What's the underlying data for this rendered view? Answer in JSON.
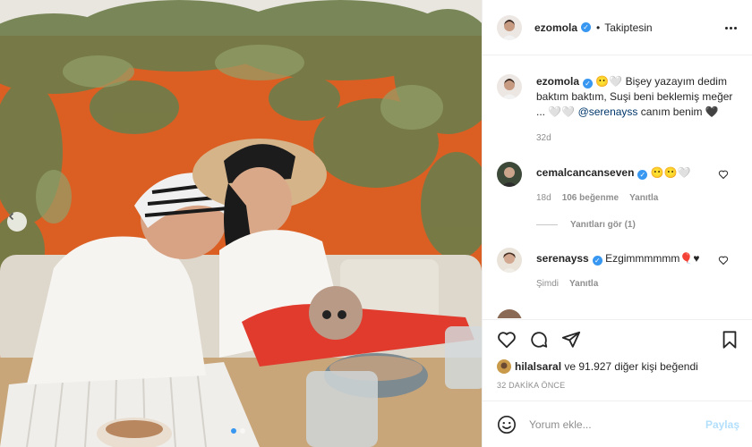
{
  "post": {
    "author": "ezomola",
    "follow_status": "Takiptesin",
    "caption_text": "😶🤍 Bişey yazayım dedim baktım baktım, Suşi beni beklemiş meğer ... 🤍🤍",
    "caption_mention": "@serenayss",
    "caption_tail": "canım benim 🖤",
    "caption_time": "32d"
  },
  "comments": [
    {
      "user": "cemalcancanseven",
      "text": "😶😶🤍",
      "time": "18d",
      "likes": "106 beğenme",
      "reply": "Yanıtla",
      "view_replies": "Yanıtları gör (1)"
    },
    {
      "user": "serenayss",
      "text": "Ezgimmmmmm🎈♥",
      "time": "Şimdi",
      "reply": "Yanıtla"
    }
  ],
  "likes": {
    "user": "hilalsaral",
    "rest": "ve 91.927 diğer kişi beğendi"
  },
  "posted_ago": "32 DAKİKA ÖNCE",
  "comment_box": {
    "placeholder": "Yorum ekle...",
    "post_label": "Paylaş"
  },
  "icons": {
    "like": "heart-icon",
    "comment": "comment-icon",
    "share": "paper-plane-icon",
    "save": "bookmark-icon",
    "emoji": "smiley-icon",
    "prev": "chevron-left-icon",
    "more": "ellipsis-icon"
  },
  "carousel": {
    "slides": 2,
    "active": 1
  },
  "colors": {
    "accent": "#3897f0",
    "text": "#262626",
    "muted": "#8e8e8e",
    "post_disabled": "#b2dffc"
  }
}
